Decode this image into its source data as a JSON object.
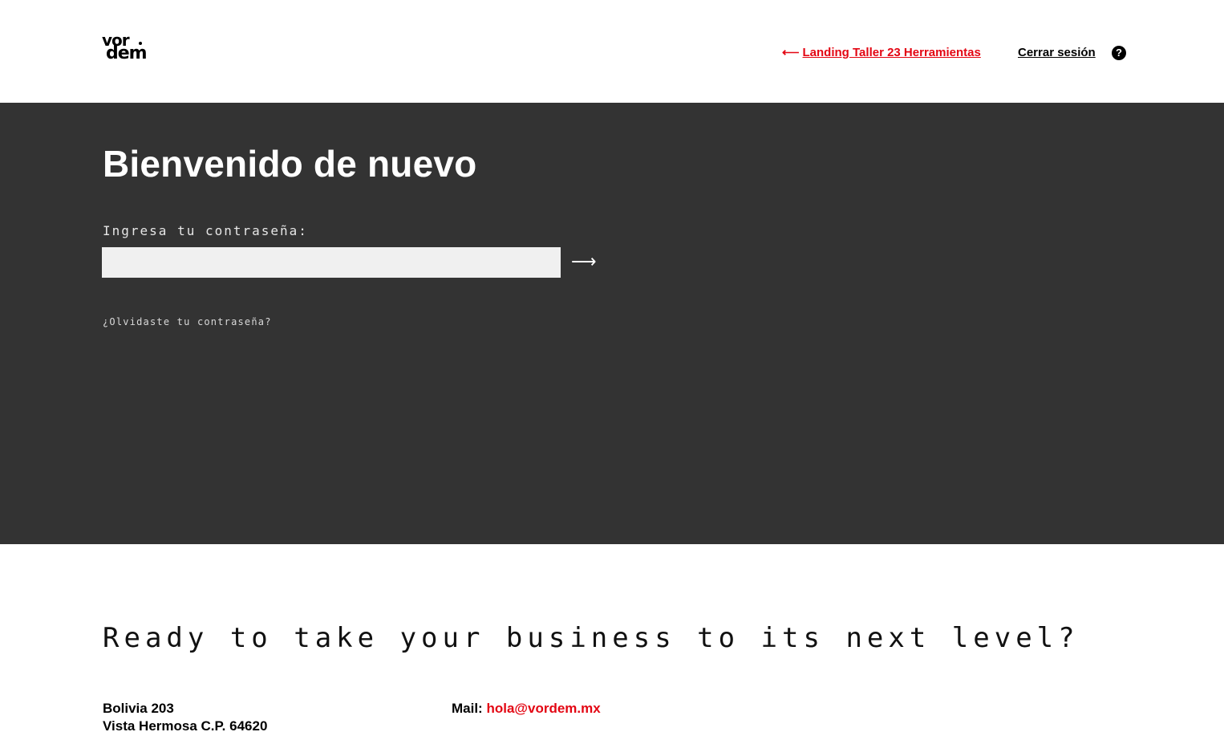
{
  "header": {
    "logo_top": "vor",
    "logo_bottom": "dem",
    "back_arrow": "⟵",
    "back_link": "Landing Taller 23 Herramientas",
    "logout_link": "Cerrar sesión",
    "help_icon": "?"
  },
  "login": {
    "title": "Bienvenido de nuevo",
    "password_label": "Ingresa tu contraseña:",
    "password_value": "",
    "submit_arrow": "⟶",
    "forgot_link": "¿Olvidaste tu contraseña?"
  },
  "footer": {
    "cta": "Ready to take your business to its next level?",
    "address_line1": "Bolivia 203",
    "address_line2": "Vista Hermosa C.P. 64620",
    "mail_label": "Mail:",
    "mail_value": "hola@vordem.mx"
  },
  "colors": {
    "accent": "#e30613",
    "hero_bg": "#333333",
    "input_bg": "#f0f0f0"
  }
}
